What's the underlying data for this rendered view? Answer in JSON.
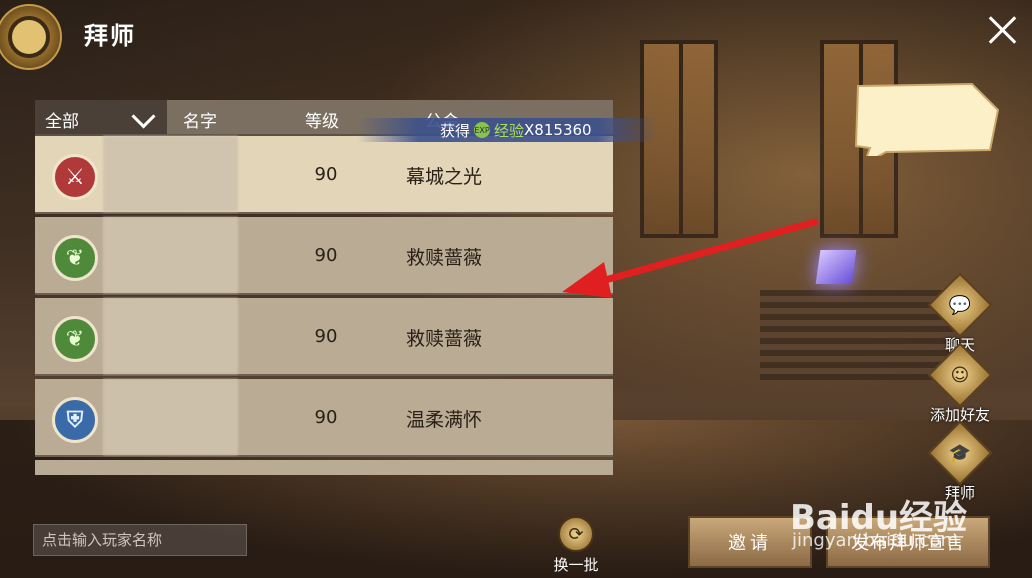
{
  "header": {
    "title": "拜师"
  },
  "table": {
    "filter_label": "全部",
    "columns": {
      "name": "名字",
      "level": "等级",
      "guild": "公会"
    },
    "rows": [
      {
        "level": "90",
        "guild": "幕城之光",
        "icon": "sword-class-icon",
        "selected": true
      },
      {
        "level": "90",
        "guild": "救赎蔷薇",
        "icon": "leaf-class-icon"
      },
      {
        "level": "90",
        "guild": "救赎蔷薇",
        "icon": "leaf-class-icon"
      },
      {
        "level": "90",
        "guild": "温柔满怀",
        "icon": "shield-class-icon"
      }
    ]
  },
  "exp_banner": {
    "get": "获得",
    "badge": "EXP",
    "name": "经验",
    "amount": "X815360"
  },
  "side_buttons": {
    "chat": "聊天",
    "add_friend": "添加好友",
    "mentor": "拜师"
  },
  "bottom": {
    "search_placeholder": "点击输入玩家名称",
    "refresh_label": "换一批",
    "invite_label": "邀请",
    "publish_label": "发布拜师宣言"
  },
  "watermark": {
    "logo": "Baidu经验",
    "url": "jingyan.baidu.com"
  },
  "colors": {
    "accent_gold": "#c59a48",
    "exp_green": "#a8e05a",
    "arrow_red": "#e02020",
    "row_selected": "#e3d6b8"
  }
}
